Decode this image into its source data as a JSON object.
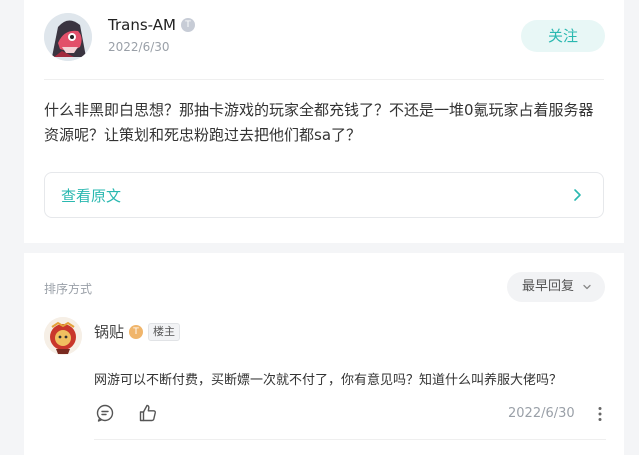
{
  "post": {
    "author": "Trans-AM",
    "level_badge": "T",
    "date": "2022/6/30",
    "follow_label": "关注",
    "body": "什么非黑即白思想？那抽卡游戏的玩家全都充钱了？不还是一堆0氪玩家占着服务器资源呢？让策划和死忠粉跑过去把他们都sa了？",
    "view_original_label": "查看原文",
    "icons": {
      "avatar": "pink-creature-avatar",
      "chevron": "chevron-right-icon"
    }
  },
  "replies_section": {
    "sort_label": "排序方式",
    "sort_value": "最早回复",
    "reply": {
      "author": "锅贴",
      "level_badge": "T",
      "op_badge": "楼主",
      "text": "网游可以不断付费，买断嫖一次就不付了，你有意见吗？知道什么叫养服大佬吗？",
      "date": "2022/6/30",
      "icons": [
        "comment-icon",
        "like-icon",
        "more-icon"
      ]
    }
  },
  "colors": {
    "accent": "#2ab8b0",
    "follow_bg": "#e8f7f6",
    "page_bg": "#f4f5f7"
  }
}
